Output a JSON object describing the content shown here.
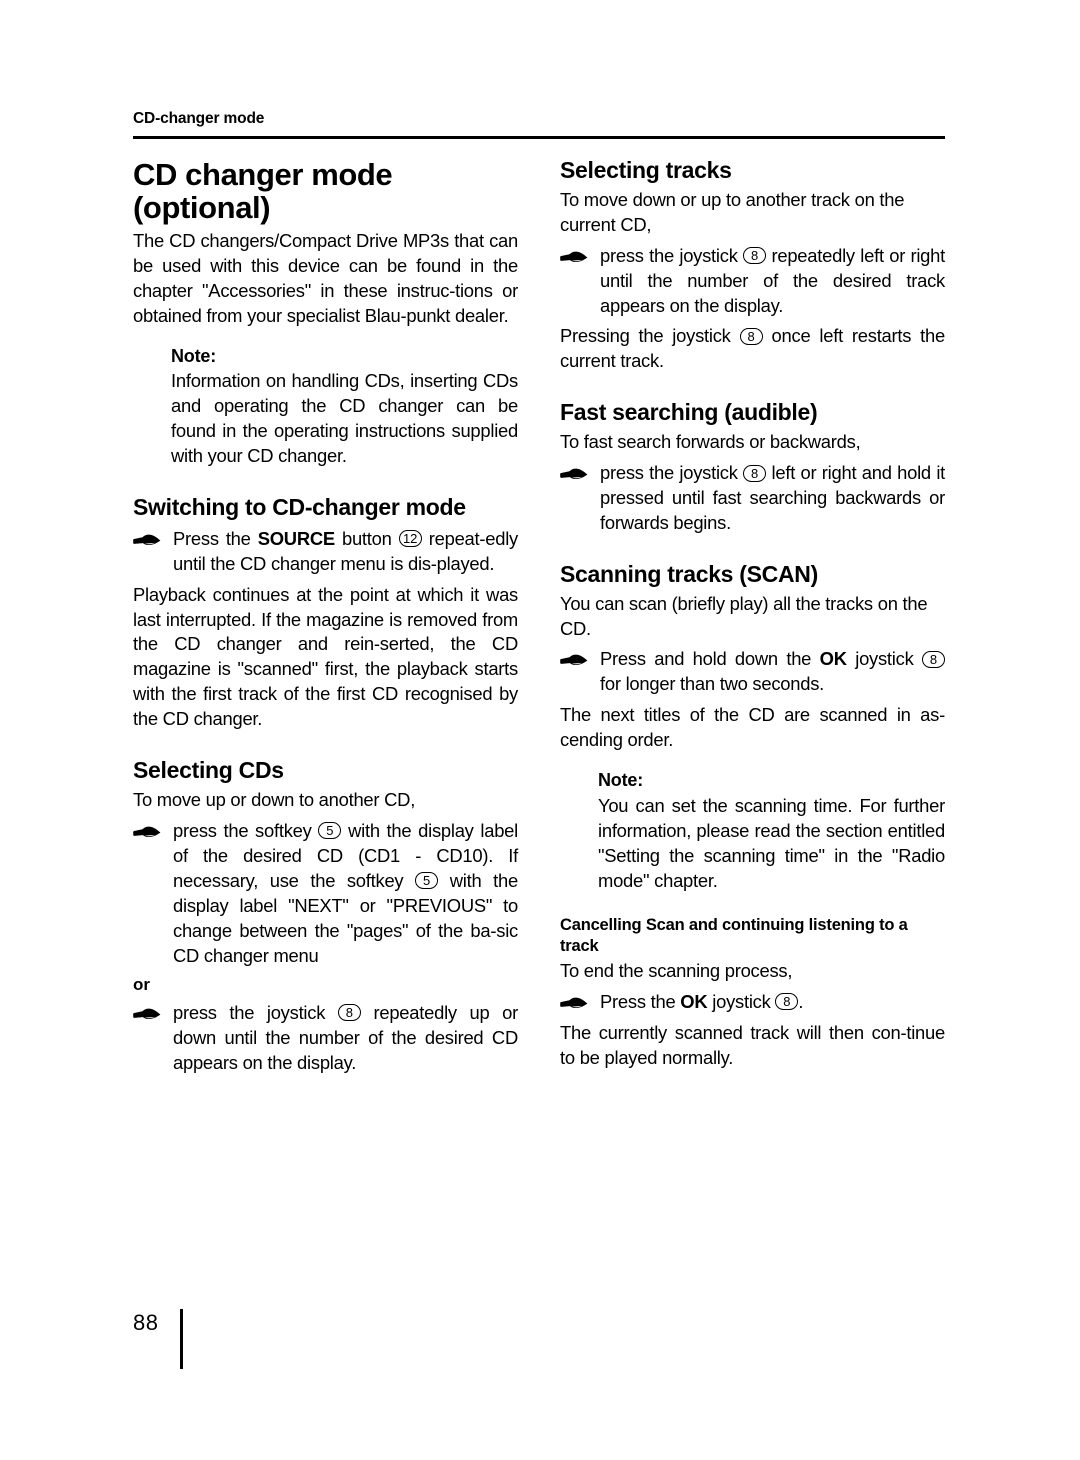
{
  "header": {
    "running_title": "CD-changer mode"
  },
  "footer": {
    "page_number": "88"
  },
  "icons": {
    "bullet": "pointing-hand-icon"
  },
  "left_column": {
    "title_line1": "CD changer mode",
    "title_line2": "(optional)",
    "intro": "The CD changers/Compact Drive MP3s that can be used with this device can be found in the chapter \"Accessories\" in these instruc-tions or obtained from your specialist Blau-punkt dealer.",
    "note": {
      "label": "Note:",
      "text": "Information on handling CDs, inserting CDs and operating the CD changer can be found in the operating instructions supplied with your CD changer."
    },
    "section_switching": {
      "heading": "Switching to CD-changer mode",
      "bullet_pre": "Press the ",
      "bullet_kw": "SOURCE",
      "bullet_mid": " button ",
      "bullet_key": "12",
      "bullet_post": " repeat-edly until the CD changer menu is dis-played.",
      "paragraph": "Playback continues at the point at which it was last interrupted. If the magazine is removed from the CD changer and rein-serted, the CD magazine is \"scanned\" first, the playback starts with the first track of the first CD recognised by the CD changer."
    },
    "section_selecting_cds": {
      "heading": "Selecting CDs",
      "lead": "To move up or down to another CD,",
      "bullet1_pre": "press the softkey ",
      "bullet1_key1": "5",
      "bullet1_mid": " with the display label of the desired CD (CD1 - CD10). If necessary, use the softkey ",
      "bullet1_key2": "5",
      "bullet1_post": " with the display label \"NEXT\" or \"PREVIOUS\" to change between the \"pages\" of the ba-sic CD changer menu",
      "or_label": "or",
      "bullet2_pre": "press the joystick ",
      "bullet2_key": "8",
      "bullet2_post": " repeatedly up or down until the number of the desired CD appears on the display."
    }
  },
  "right_column": {
    "section_selecting_tracks": {
      "heading": "Selecting tracks",
      "lead": "To move down or up to another track on the current CD,",
      "bullet_pre": "press the joystick ",
      "bullet_key": "8",
      "bullet_post": " repeatedly left or right until the number of the desired track appears on the display.",
      "para_pre": "Pressing the joystick ",
      "para_key": "8",
      "para_post": " once left restarts the current track."
    },
    "section_fast_searching": {
      "heading": "Fast searching (audible)",
      "lead": "To fast search forwards or backwards,",
      "bullet_pre": "press the joystick ",
      "bullet_key": "8",
      "bullet_post": " left or right and hold it pressed until fast searching backwards or forwards begins."
    },
    "section_scanning": {
      "heading": "Scanning tracks (SCAN)",
      "lead": "You can scan (briefly play) all the tracks on the CD.",
      "bullet_pre": "Press and hold down the ",
      "bullet_kw": "OK",
      "bullet_mid": " joystick ",
      "bullet_key": "8",
      "bullet_post": " for longer than two seconds.",
      "paragraph": "The next titles of the CD are scanned in as-cending order.",
      "note": {
        "label": "Note:",
        "text": "You can set the scanning time. For further information, please read the section entitled \"Setting the scanning time\" in the \"Radio mode\" chapter."
      }
    },
    "section_cancelling": {
      "heading": "Cancelling Scan and continuing listening to a track",
      "lead": "To end the scanning process,",
      "bullet_pre": "Press the ",
      "bullet_kw": "OK",
      "bullet_mid": " joystick ",
      "bullet_key": "8",
      "bullet_post": ".",
      "paragraph": "The currently scanned track will then con-tinue to be played normally."
    }
  }
}
